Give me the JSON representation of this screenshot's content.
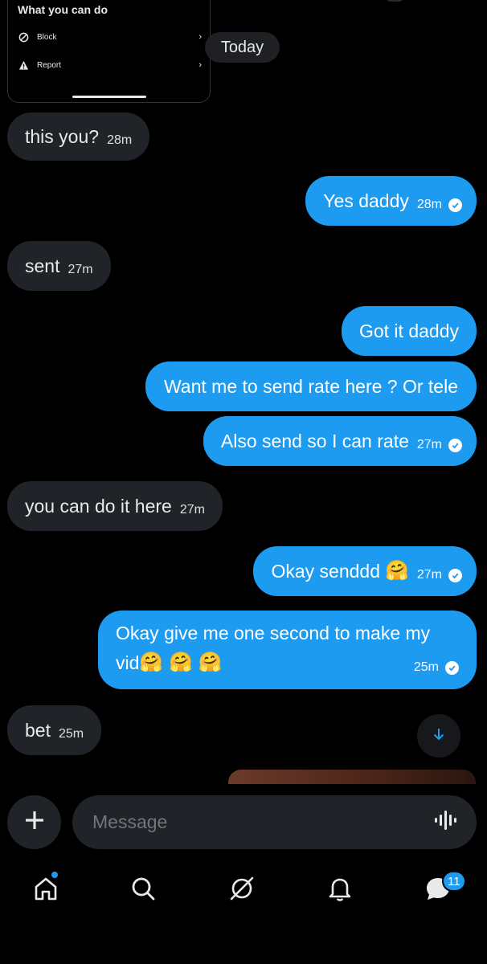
{
  "top_card": {
    "heading": "What you can do",
    "items": [
      {
        "label": "Block",
        "icon": "block-icon"
      },
      {
        "label": "Report",
        "icon": "warning-icon"
      }
    ]
  },
  "date_separator": "Today",
  "messages": [
    {
      "direction": "in",
      "text": "this you?",
      "time": "28m"
    },
    {
      "direction": "out",
      "text": "Yes daddy",
      "time": "28m",
      "read": true
    },
    {
      "direction": "in",
      "text": "sent",
      "time": "27m"
    },
    {
      "direction": "out",
      "text": "Got it daddy"
    },
    {
      "direction": "out",
      "text": "Want me to send rate here ? Or tele"
    },
    {
      "direction": "out",
      "text": "Also send so I can rate",
      "time": "27m",
      "read": true
    },
    {
      "direction": "in",
      "text": "you can do it here",
      "time": "27m"
    },
    {
      "direction": "out",
      "text": "Okay senddd",
      "emoji": "🤗",
      "time": "27m",
      "read": true
    },
    {
      "direction": "out",
      "line1": "Okay give me one second to make my",
      "line2": "vid",
      "emoji": "🤗 🤗 🤗",
      "time": "25m",
      "read": true
    },
    {
      "direction": "in",
      "text": "bet",
      "time": "25m"
    }
  ],
  "composer": {
    "placeholder": "Message"
  },
  "nav": {
    "messages_badge": "11"
  },
  "colors": {
    "accent": "#1d9bf0",
    "incoming_bubble": "#202327",
    "background": "#000000"
  }
}
